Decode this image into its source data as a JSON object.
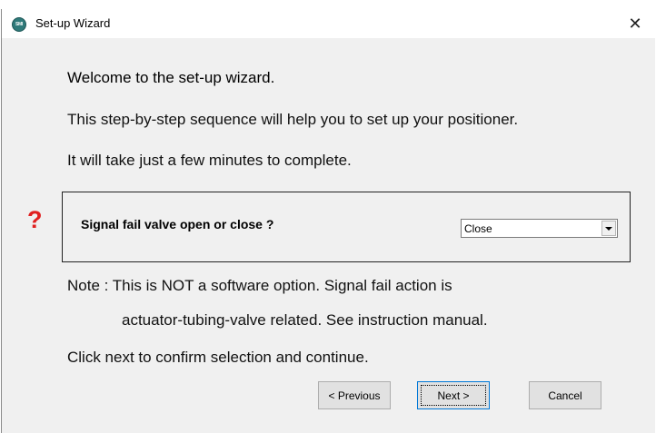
{
  "window": {
    "title": "Set-up Wizard",
    "close_glyph": "✕",
    "icon": "app-logo-icon",
    "icon_text": "SMI"
  },
  "content": {
    "heading": "Welcome to the set-up wizard.",
    "intro_line1": "This step-by-step sequence will help you to set up your positioner.",
    "intro_line2": "It will take just a few minutes to complete.",
    "question_mark": "?",
    "question_label": "Signal fail valve open or close ?",
    "select": {
      "value": "Close"
    },
    "note_line1": "Note : This is NOT a software option. Signal fail action is",
    "note_line2": "actuator-tubing-valve related. See instruction manual.",
    "footer_text": "Click next to confirm selection and continue."
  },
  "buttons": {
    "previous": "< Previous",
    "next": "Next >",
    "cancel": "Cancel"
  },
  "colors": {
    "question_mark": "#e02020",
    "dialog_background": "#f0f0f0",
    "focus_border": "#0078d7"
  }
}
